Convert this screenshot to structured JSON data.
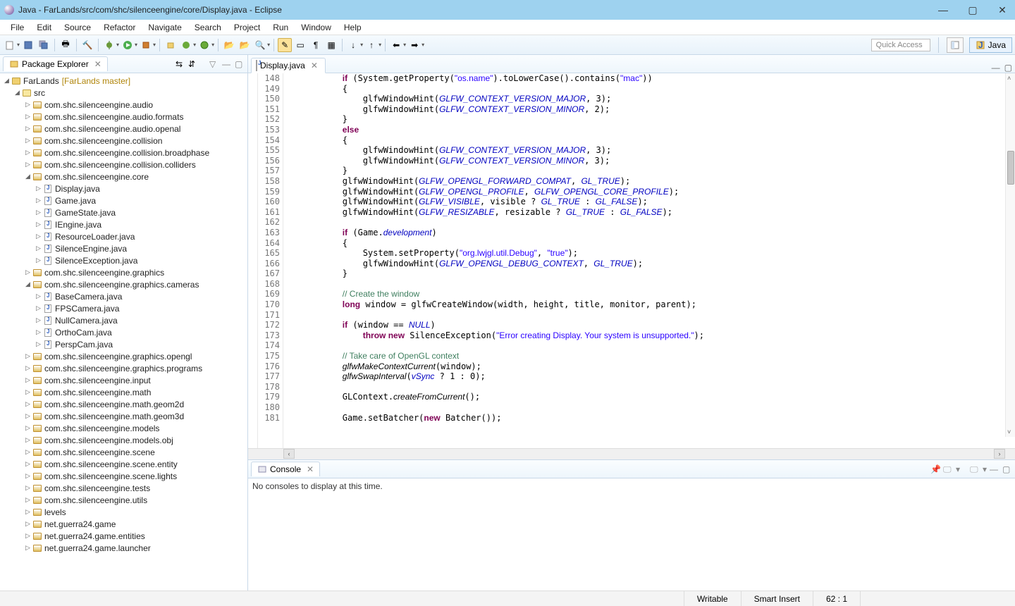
{
  "window": {
    "title": "Java - FarLands/src/com/shc/silenceengine/core/Display.java - Eclipse"
  },
  "menu": [
    "File",
    "Edit",
    "Source",
    "Refactor",
    "Navigate",
    "Search",
    "Project",
    "Run",
    "Window",
    "Help"
  ],
  "quick_access": {
    "placeholder": "Quick Access"
  },
  "perspective": {
    "label": "Java"
  },
  "package_explorer": {
    "title": "Package Explorer",
    "project": "FarLands",
    "repo": "[FarLands master]",
    "src": "src",
    "packages_top": [
      "com.shc.silenceengine.audio",
      "com.shc.silenceengine.audio.formats",
      "com.shc.silenceengine.audio.openal",
      "com.shc.silenceengine.collision",
      "com.shc.silenceengine.collision.broadphase",
      "com.shc.silenceengine.collision.colliders"
    ],
    "core_pkg": "com.shc.silenceengine.core",
    "core_files": [
      "Display.java",
      "Game.java",
      "GameState.java",
      "IEngine.java",
      "ResourceLoader.java",
      "SilenceEngine.java",
      "SilenceException.java"
    ],
    "graphics_pkg": "com.shc.silenceengine.graphics",
    "cameras_pkg": "com.shc.silenceengine.graphics.cameras",
    "camera_files": [
      "BaseCamera.java",
      "FPSCamera.java",
      "NullCamera.java",
      "OrthoCam.java",
      "PerspCam.java"
    ],
    "packages_bottom": [
      "com.shc.silenceengine.graphics.opengl",
      "com.shc.silenceengine.graphics.programs",
      "com.shc.silenceengine.input",
      "com.shc.silenceengine.math",
      "com.shc.silenceengine.math.geom2d",
      "com.shc.silenceengine.math.geom3d",
      "com.shc.silenceengine.models",
      "com.shc.silenceengine.models.obj",
      "com.shc.silenceengine.scene",
      "com.shc.silenceengine.scene.entity",
      "com.shc.silenceengine.scene.lights",
      "com.shc.silenceengine.tests",
      "com.shc.silenceengine.utils",
      "levels",
      "net.guerra24.game",
      "net.guerra24.game.entities",
      "net.guerra24.game.launcher"
    ]
  },
  "editor": {
    "tab": "Display.java",
    "first_line": 148,
    "lines": [
      {
        "t": "if",
        "tok": [
          [
            "kw",
            "if"
          ],
          [
            "p",
            " (System.getProperty("
          ],
          [
            "str",
            "\"os.name\""
          ],
          [
            "p",
            ").toLowerCase().contains("
          ],
          [
            "str",
            "\"mac\""
          ],
          [
            "p",
            "))"
          ]
        ]
      },
      {
        "t": "{",
        "tok": [
          [
            "p",
            "{"
          ]
        ]
      },
      {
        "t": "",
        "tok": [
          [
            "p",
            "    glfwWindowHint("
          ],
          [
            "const",
            "GLFW_CONTEXT_VERSION_MAJOR"
          ],
          [
            "p",
            ", 3);"
          ]
        ]
      },
      {
        "t": "",
        "tok": [
          [
            "p",
            "    glfwWindowHint("
          ],
          [
            "const",
            "GLFW_CONTEXT_VERSION_MINOR"
          ],
          [
            "p",
            ", 2);"
          ]
        ]
      },
      {
        "t": "}",
        "tok": [
          [
            "p",
            "}"
          ]
        ]
      },
      {
        "t": "else",
        "tok": [
          [
            "kw",
            "else"
          ]
        ]
      },
      {
        "t": "{",
        "tok": [
          [
            "p",
            "{"
          ]
        ]
      },
      {
        "t": "",
        "tok": [
          [
            "p",
            "    glfwWindowHint("
          ],
          [
            "const",
            "GLFW_CONTEXT_VERSION_MAJOR"
          ],
          [
            "p",
            ", 3);"
          ]
        ]
      },
      {
        "t": "",
        "tok": [
          [
            "p",
            "    glfwWindowHint("
          ],
          [
            "const",
            "GLFW_CONTEXT_VERSION_MINOR"
          ],
          [
            "p",
            ", 3);"
          ]
        ]
      },
      {
        "t": "}",
        "tok": [
          [
            "p",
            "}"
          ]
        ]
      },
      {
        "t": "",
        "tok": [
          [
            "p",
            "glfwWindowHint("
          ],
          [
            "const",
            "GLFW_OPENGL_FORWARD_COMPAT"
          ],
          [
            "p",
            ", "
          ],
          [
            "const",
            "GL_TRUE"
          ],
          [
            "p",
            ");"
          ]
        ]
      },
      {
        "t": "",
        "tok": [
          [
            "p",
            "glfwWindowHint("
          ],
          [
            "const",
            "GLFW_OPENGL_PROFILE"
          ],
          [
            "p",
            ", "
          ],
          [
            "const",
            "GLFW_OPENGL_CORE_PROFILE"
          ],
          [
            "p",
            ");"
          ]
        ]
      },
      {
        "t": "",
        "tok": [
          [
            "p",
            "glfwWindowHint("
          ],
          [
            "const",
            "GLFW_VISIBLE"
          ],
          [
            "p",
            ", visible ? "
          ],
          [
            "const",
            "GL_TRUE"
          ],
          [
            "p",
            " : "
          ],
          [
            "const",
            "GL_FALSE"
          ],
          [
            "p",
            ");"
          ]
        ]
      },
      {
        "t": "",
        "tok": [
          [
            "p",
            "glfwWindowHint("
          ],
          [
            "const",
            "GLFW_RESIZABLE"
          ],
          [
            "p",
            ", resizable ? "
          ],
          [
            "const",
            "GL_TRUE"
          ],
          [
            "p",
            " : "
          ],
          [
            "const",
            "GL_FALSE"
          ],
          [
            "p",
            ");"
          ]
        ]
      },
      {
        "t": "",
        "tok": []
      },
      {
        "t": "",
        "tok": [
          [
            "kw",
            "if"
          ],
          [
            "p",
            " (Game."
          ],
          [
            "fld",
            "development"
          ],
          [
            "p",
            ")"
          ]
        ]
      },
      {
        "t": "{",
        "tok": [
          [
            "p",
            "{"
          ]
        ]
      },
      {
        "t": "",
        "tok": [
          [
            "p",
            "    System.setProperty("
          ],
          [
            "str",
            "\"org.lwjgl.util.Debug\""
          ],
          [
            "p",
            ", "
          ],
          [
            "str",
            "\"true\""
          ],
          [
            "p",
            ");"
          ]
        ]
      },
      {
        "t": "",
        "tok": [
          [
            "p",
            "    glfwWindowHint("
          ],
          [
            "const",
            "GLFW_OPENGL_DEBUG_CONTEXT"
          ],
          [
            "p",
            ", "
          ],
          [
            "const",
            "GL_TRUE"
          ],
          [
            "p",
            ");"
          ]
        ]
      },
      {
        "t": "}",
        "tok": [
          [
            "p",
            "}"
          ]
        ]
      },
      {
        "t": "",
        "tok": []
      },
      {
        "t": "",
        "tok": [
          [
            "cm",
            "// Create the window"
          ]
        ]
      },
      {
        "t": "",
        "tok": [
          [
            "kw",
            "long"
          ],
          [
            "p",
            " window = glfwCreateWindow(width, height, title, monitor, parent);"
          ]
        ]
      },
      {
        "t": "",
        "tok": []
      },
      {
        "t": "",
        "tok": [
          [
            "kw",
            "if"
          ],
          [
            "p",
            " (window == "
          ],
          [
            "const",
            "NULL"
          ],
          [
            "p",
            ")"
          ]
        ]
      },
      {
        "t": "",
        "tok": [
          [
            "p",
            "    "
          ],
          [
            "kw",
            "throw new"
          ],
          [
            "p",
            " SilenceException("
          ],
          [
            "str",
            "\"Error creating Display. Your system is unsupported.\""
          ],
          [
            "p",
            ");"
          ]
        ]
      },
      {
        "t": "",
        "tok": []
      },
      {
        "t": "",
        "tok": [
          [
            "cm",
            "// Take care of OpenGL context"
          ]
        ]
      },
      {
        "t": "",
        "tok": [
          [
            "mtd",
            "glfwMakeContextCurrent"
          ],
          [
            "p",
            "(window);"
          ]
        ]
      },
      {
        "t": "",
        "tok": [
          [
            "mtd",
            "glfwSwapInterval"
          ],
          [
            "p",
            "("
          ],
          [
            "fld",
            "vSync"
          ],
          [
            "p",
            " ? 1 : 0);"
          ]
        ]
      },
      {
        "t": "",
        "tok": []
      },
      {
        "t": "",
        "tok": [
          [
            "p",
            "GLContext."
          ],
          [
            "mtd",
            "createFromCurrent"
          ],
          [
            "p",
            "();"
          ]
        ]
      },
      {
        "t": "",
        "tok": []
      },
      {
        "t": "",
        "tok": [
          [
            "p",
            "Game.setBatcher("
          ],
          [
            "kw",
            "new"
          ],
          [
            "p",
            " Batcher());"
          ]
        ]
      }
    ]
  },
  "console": {
    "title": "Console",
    "message": "No consoles to display at this time."
  },
  "status": {
    "writable": "Writable",
    "insert": "Smart Insert",
    "pos": "62 : 1"
  }
}
